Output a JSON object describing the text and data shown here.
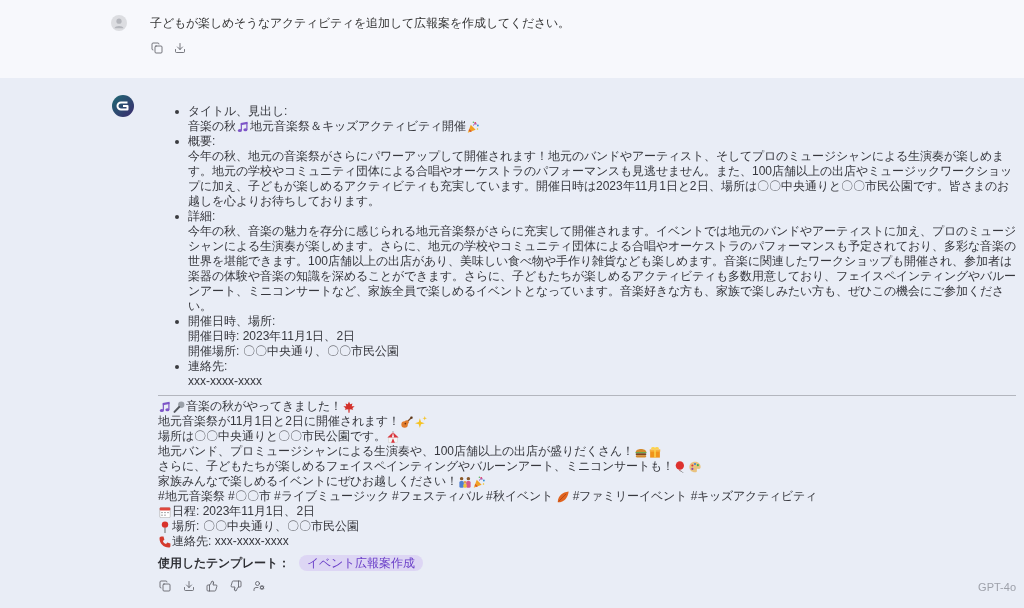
{
  "user_message": {
    "text": "子どもが楽しめそうなアクティビティを追加して広報案を作成してください。"
  },
  "assistant_message": {
    "outline": [
      {
        "label": "タイトル、見出し:",
        "lines": [
          {
            "segments": [
              "音楽の秋",
              "地元音楽祭＆キッズアクティビティ開催"
            ]
          }
        ]
      },
      {
        "label": "概要:",
        "lines": [
          {
            "segments": [
              "今年の秋、地元の音楽祭がさらにパワーアップして開催されます！地元のバンドやアーティスト、そしてプロのミュージシャンによる生演奏が楽しめます。地元の学校やコミュニティ団体による合唱やオーケストラのパフォーマンスも見逃せません。また、100店舗以上の出店やミュージックワークショップに加え、子どもが楽しめるアクティビティも充実しています。開催日時は2023年11月1日と2日、場所は〇〇中央通りと〇〇市民公園です。皆さまのお越しを心よりお待ちしております。"
            ]
          }
        ]
      },
      {
        "label": "詳細:",
        "lines": [
          {
            "segments": [
              "今年の秋、音楽の魅力を存分に感じられる地元音楽祭がさらに充実して開催されます。イベントでは地元のバンドやアーティストに加え、プロのミュージシャンによる生演奏が楽しめます。さらに、地元の学校やコミュニティ団体による合唱やオーケストラのパフォーマンスも予定されており、多彩な音楽の世界を堪能できます。100店舗以上の出店があり、美味しい食べ物や手作り雑貨なども楽しめます。音楽に関連したワークショップも開催され、参加者は楽器の体験や音楽の知識を深めることができます。さらに、子どもたちが楽しめるアクティビティも多数用意しており、フェイスペインティングやバルーンアート、ミニコンサートなど、家族全員で楽しめるイベントとなっています。音楽好きな方も、家族で楽しみたい方も、ぜひこの機会にご参加ください。"
            ]
          }
        ]
      },
      {
        "label": "開催日時、場所:",
        "lines": [
          {
            "segments": [
              "開催日時: 2023年11月1日、2日"
            ]
          },
          {
            "segments": [
              "開催場所: 〇〇中央通り、〇〇市民公園"
            ]
          }
        ]
      },
      {
        "label": "連絡先:",
        "lines": [
          {
            "segments": [
              "xxx-xxxx-xxxx"
            ]
          }
        ]
      }
    ],
    "post_lines": [
      {
        "segments": [
          "音楽の秋がやってきました！"
        ]
      },
      {
        "segments": [
          "地元音楽祭が11月1日と2日に開催されます！"
        ]
      },
      {
        "segments": [
          "場所は〇〇中央通りと〇〇市民公園です。"
        ]
      },
      {
        "segments": [
          "地元バンド、プロミュージシャンによる生演奏や、100店舗以上の出店が盛りだくさん！"
        ]
      },
      {
        "segments": [
          "さらに、子どもたちが楽しめるフェイスペインティングやバルーンアート、ミニコンサートも！"
        ]
      },
      {
        "segments": [
          "家族みんなで楽しめるイベントにぜひお越しください！"
        ]
      },
      {
        "segments": [
          "#地元音楽祭 #〇〇市 #ライブミュージック #フェスティバル #秋イベント",
          "#ファミリーイベント #キッズアクティビティ"
        ]
      },
      {
        "segments": [
          "日程: 2023年11月1日、2日"
        ]
      },
      {
        "segments": [
          "場所: 〇〇中央通り、〇〇市民公園"
        ]
      },
      {
        "segments": [
          "連絡先: xxx-xxxx-xxxx"
        ]
      }
    ],
    "template": {
      "label": "使用したテンプレート：",
      "tag": "イベント広報案作成"
    },
    "model": "GPT-4o"
  }
}
